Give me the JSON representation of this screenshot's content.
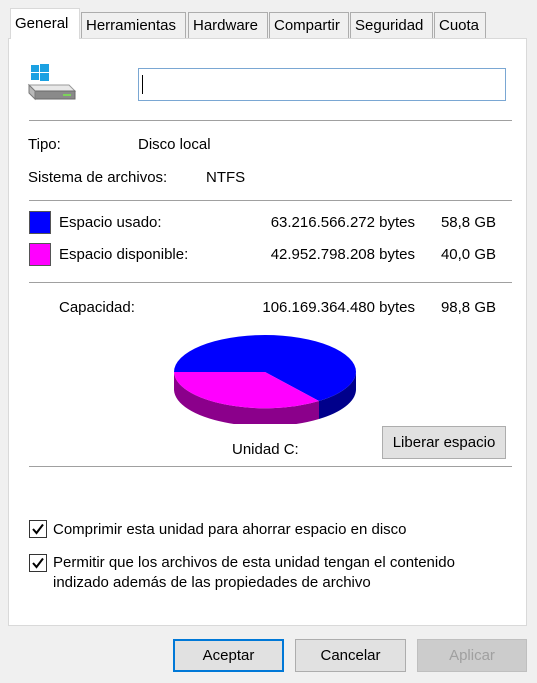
{
  "tabs": [
    "General",
    "Herramientas",
    "Hardware",
    "Compartir",
    "Seguridad",
    "Cuota"
  ],
  "volume_name_value": "",
  "info": {
    "type_label": "Tipo:",
    "type_value": "Disco local",
    "fs_label": "Sistema de archivos:",
    "fs_value": "NTFS"
  },
  "space": {
    "used_label": "Espacio usado:",
    "used_bytes": "63.216.566.272 bytes",
    "used_gb": "58,8 GB",
    "free_label": "Espacio disponible:",
    "free_bytes": "42.952.798.208 bytes",
    "free_gb": "40,0 GB",
    "capacity_label": "Capacidad:",
    "capacity_bytes": "106.169.364.480 bytes",
    "capacity_gb": "98,8 GB",
    "used_color": "#0000ff",
    "free_color": "#ff00ff"
  },
  "drive_label": "Unidad C:",
  "cleanup_button": "Liberar espacio",
  "options": {
    "compress_label": "Comprimir esta unidad para ahorrar espacio en disco",
    "compress_checked": true,
    "index_label_line1": "Permitir que los archivos de esta unidad tengan el contenido",
    "index_label_line2": "indizado además de las propiedades de archivo",
    "index_checked": true
  },
  "buttons": {
    "ok": "Aceptar",
    "cancel": "Cancelar",
    "apply": "Aplicar"
  },
  "icons": {
    "drive": "windows-drive-icon",
    "check": "checkmark-icon"
  }
}
